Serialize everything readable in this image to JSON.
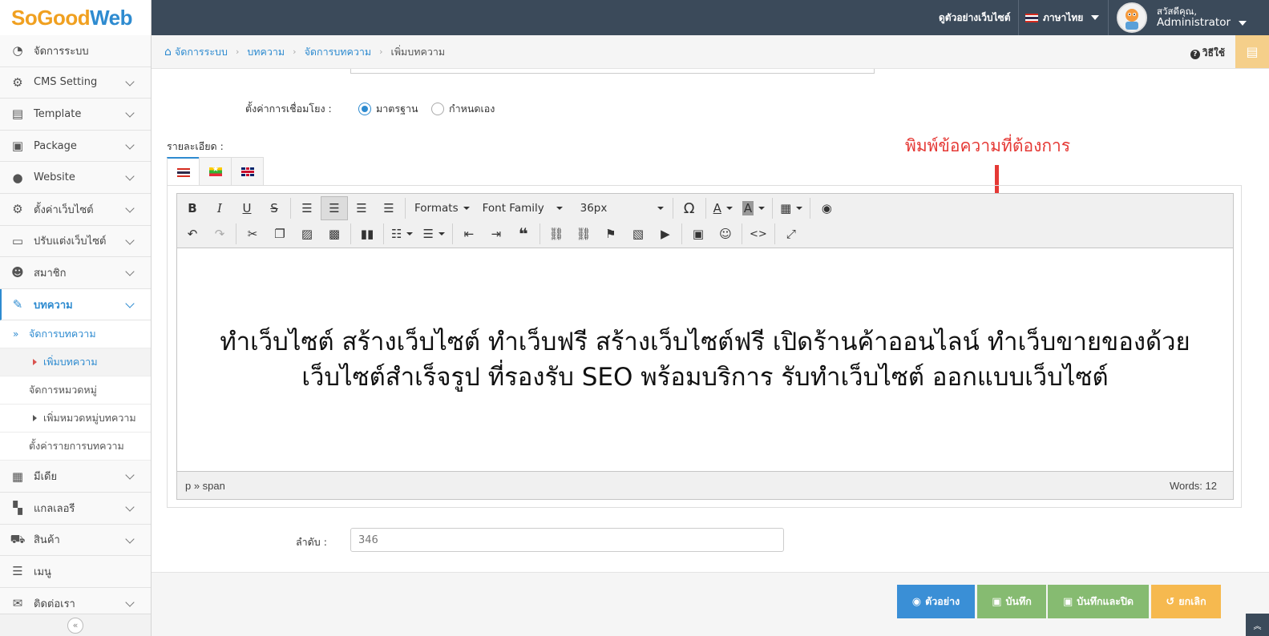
{
  "brand": {
    "part1": "SoGood",
    "part2": "Web"
  },
  "topbar": {
    "preview_site": "ดูตัวอย่างเว็บไซต์",
    "language": "ภาษาไทย",
    "greeting": "สวัสดีคุณ,",
    "username": "Administrator"
  },
  "sidebar": {
    "items": [
      {
        "label": "จัดการระบบ",
        "icon": "dashboard-icon"
      },
      {
        "label": "CMS Setting",
        "icon": "gear-icon"
      },
      {
        "label": "Template",
        "icon": "template-icon"
      },
      {
        "label": "Package",
        "icon": "gift-icon"
      },
      {
        "label": "Website",
        "icon": "globe-icon"
      },
      {
        "label": "ตั้งค่าเว็บไซต์",
        "icon": "gear-icon"
      },
      {
        "label": "ปรับแต่งเว็บไซต์",
        "icon": "monitor-icon"
      },
      {
        "label": "สมาชิก",
        "icon": "user-icon"
      },
      {
        "label": "บทความ",
        "icon": "edit-icon"
      },
      {
        "label": "มีเดีย",
        "icon": "film-icon"
      },
      {
        "label": "แกลเลอรี",
        "icon": "grid-icon"
      },
      {
        "label": "สินค้า",
        "icon": "cart-icon"
      },
      {
        "label": "เมนู",
        "icon": "menu-icon"
      },
      {
        "label": "ติดต่อเรา",
        "icon": "envelope-icon"
      }
    ],
    "sub": [
      {
        "label": "จัดการบทความ"
      },
      {
        "label": "เพิ่มบทความ"
      },
      {
        "label": "จัดการหมวดหมู่"
      },
      {
        "label": "เพิ่มหมวดหมู่บทความ"
      },
      {
        "label": "ตั้งค่ารายการบทความ"
      }
    ]
  },
  "breadcrumb": {
    "items": [
      "จัดการระบบ",
      "บทความ",
      "จัดการบทความ",
      "เพิ่มบทความ"
    ],
    "help": "วิธีใช้"
  },
  "form": {
    "link_setting_label": "ตั้งค่าการเชื่อมโยง :",
    "link_options": [
      "มาตรฐาน",
      "กำหนดเอง"
    ],
    "link_selected": "มาตรฐาน",
    "detail_label": "รายละเอียด :",
    "annotation": "พิมพ์ข้อความที่ต้องการ",
    "order_label": "ลำดับ :",
    "order_value": "346"
  },
  "editor": {
    "formats": "Formats",
    "font_family": "Font Family",
    "font_size": "36px",
    "content": "ทำเว็บไซต์ สร้างเว็บไซต์ ทำเว็บฟรี สร้างเว็บไซต์ฟรี เปิดร้านค้าออนไลน์ ทำเว็บขายของด้วยเว็บไซต์สำเร็จรูป ที่รองรับ SEO พร้อมบริการ รับทำเว็บไซต์ ออกแบบเว็บไซต์",
    "path": "p » span",
    "word_count": "Words: 12"
  },
  "footer": {
    "preview": "ตัวอย่าง",
    "save": "บันทึก",
    "save_close": "บันทึกและปิด",
    "cancel": "ยกเลิก"
  },
  "colors": {
    "accent": "#2e8bd0",
    "topbar": "#3b4a5a",
    "preview_btn": "#3a8fd6",
    "save_btn": "#86bb71",
    "cancel_btn": "#f6b94f",
    "annotation": "#e53935"
  }
}
